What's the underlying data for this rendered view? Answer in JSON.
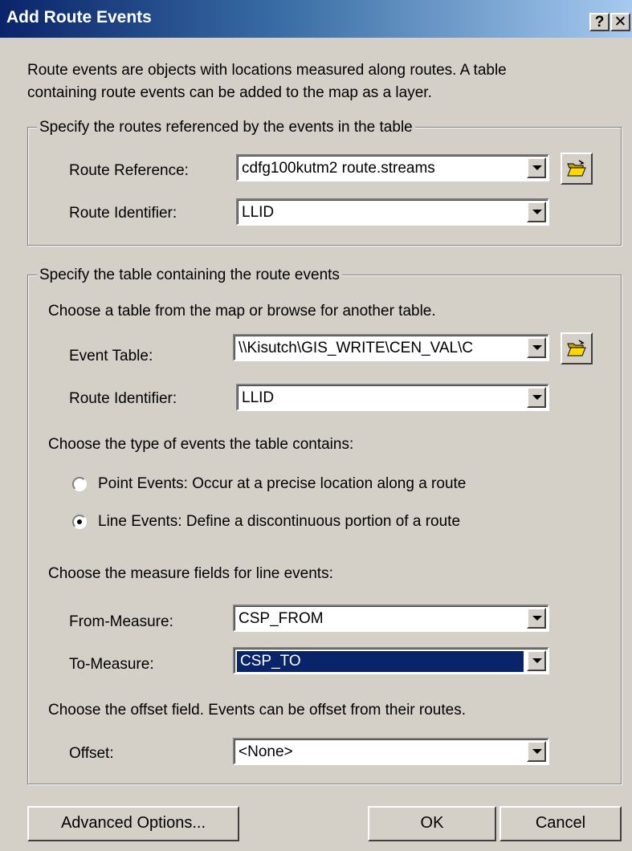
{
  "window": {
    "title": "Add Route Events",
    "help_glyph": "?",
    "close_glyph": "✕"
  },
  "intro": {
    "line1": "Route events are objects with locations measured along routes. A table",
    "line2": "containing route events can be added to the map as a layer."
  },
  "routes_group": {
    "legend": "Specify the routes referenced by the events in the table",
    "route_reference_label": "Route Reference:",
    "route_reference_value": "cdfg100kutm2 route.streams",
    "route_identifier_label": "Route Identifier:",
    "route_identifier_value": "LLID"
  },
  "events_group": {
    "legend": "Specify the table containing the route events",
    "choose_table_text": "Choose a table from the map or browse for another table.",
    "event_table_label": "Event Table:",
    "event_table_value": "\\\\Kisutch\\GIS_WRITE\\CEN_VAL\\C",
    "route_identifier_label": "Route Identifier:",
    "route_identifier_value": "LLID",
    "choose_type_text": "Choose the type of events the table contains:",
    "point_events_label": "Point Events: Occur at a precise location along a route",
    "line_events_label": "Line Events: Define a discontinuous portion of a route",
    "selected_event_type": "line",
    "measure_text": "Choose the measure fields for line events:",
    "from_measure_label": "From-Measure:",
    "from_measure_value": "CSP_FROM",
    "to_measure_label": "To-Measure:",
    "to_measure_value": "CSP_TO",
    "offset_text": "Choose the offset field. Events can be offset from their routes.",
    "offset_label": "Offset:",
    "offset_value": "<None>"
  },
  "buttons": {
    "advanced": "Advanced Options...",
    "ok": "OK",
    "cancel": "Cancel"
  },
  "icons": {
    "browse": "open-folder-icon",
    "dropdown": "chevron-down-icon"
  }
}
